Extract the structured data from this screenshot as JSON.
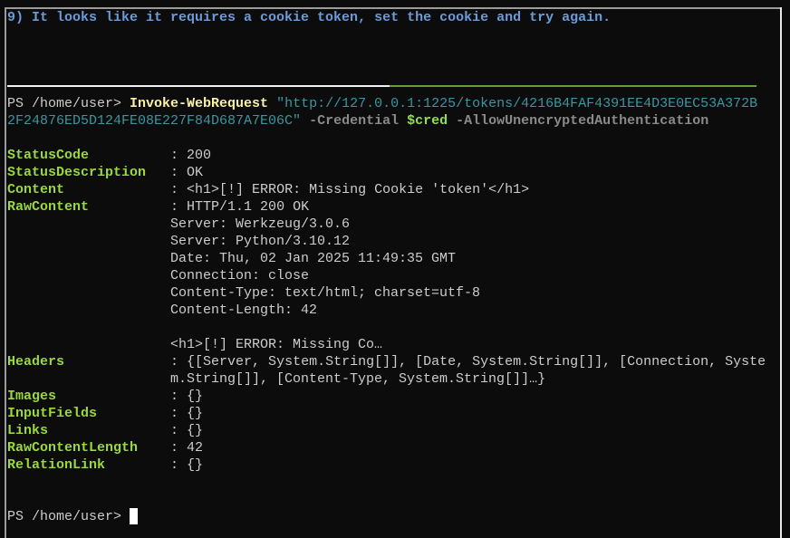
{
  "title_line": "9) It looks like it requires a cookie token, set the cookie and try again.",
  "command": {
    "prompt": "PS /home/user> ",
    "cmdlet": "Invoke-WebRequest",
    "url_part1": "\"http://127.0.0.1:1225/tokens/4216B4FAF4391EE4D3E0EC53A372B",
    "url_part2": "2F24876ED5D124FE08E227F84D687A7E06C\"",
    "credential_param": "-Credential",
    "credential_var": "$cred",
    "auth_param": "-AllowUnencryptedAuthentication"
  },
  "output": {
    "separator": " : ",
    "fields": [
      {
        "key": "StatusCode         ",
        "value": "200"
      },
      {
        "key": "StatusDescription  ",
        "value": "OK"
      },
      {
        "key": "Content            ",
        "value": "<h1>[!] ERROR: Missing Cookie 'token'</h1>"
      },
      {
        "key": "RawContent         ",
        "value": "HTTP/1.1 200 OK"
      }
    ],
    "raw_content_continuation": [
      "Server: Werkzeug/3.0.6",
      "Server: Python/3.10.12",
      "Date: Thu, 02 Jan 2025 11:49:35 GMT",
      "Connection: close",
      "Content-Type: text/html; charset=utf-8",
      "Content-Length: 42",
      "",
      "<h1>[!] ERROR: Missing Co…"
    ],
    "headers": {
      "key": "Headers            ",
      "value_line1": "{[Server, System.String[]], [Date, System.String[]], [Connection, Syste",
      "value_line2": "m.String[]], [Content-Type, System.String[]]…}"
    },
    "fields_after": [
      {
        "key": "Images             ",
        "value": "{}"
      },
      {
        "key": "InputFields        ",
        "value": "{}"
      },
      {
        "key": "Links              ",
        "value": "{}"
      },
      {
        "key": "RawContentLength   ",
        "value": "42"
      },
      {
        "key": "RelationLink       ",
        "value": "{}"
      }
    ]
  },
  "final_prompt": "PS /home/user> "
}
